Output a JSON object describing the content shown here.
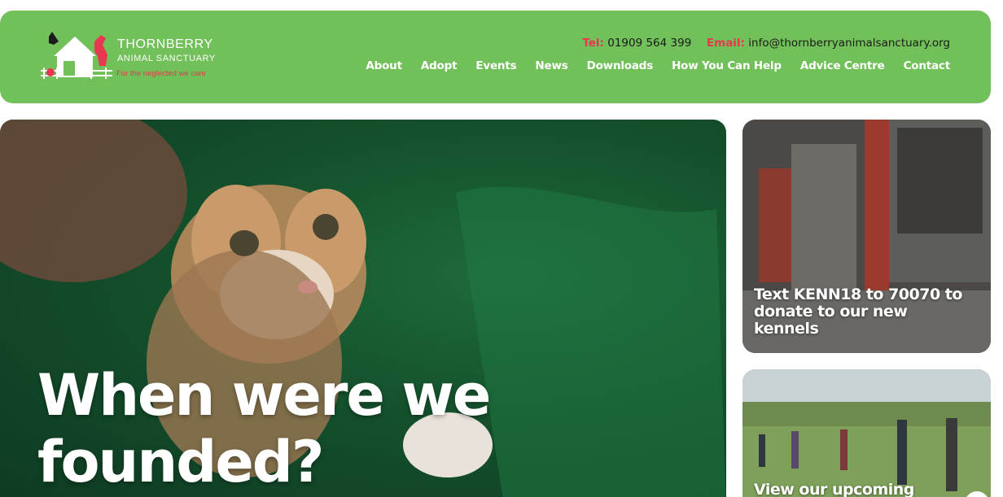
{
  "brand": {
    "name": "THORNBERRY",
    "subtitle": "ANIMAL SANCTUARY",
    "tagline": "For the neglected we care"
  },
  "contact": {
    "tel_label": "Tel:",
    "tel": "01909 564 399",
    "email_label": "Email:",
    "email": "info@thornberryanimalsanctuary.org"
  },
  "nav": {
    "items": [
      "About",
      "Adopt",
      "Events",
      "News",
      "Downloads",
      "How You Can Help",
      "Advice Centre",
      "Contact"
    ]
  },
  "hero": {
    "title": "When were we founded?"
  },
  "cards": [
    {
      "text": "Text KENN18 to 70070 to donate to our new kennels"
    },
    {
      "text": "View our upcoming"
    }
  ],
  "colors": {
    "header_green": "#72c05a",
    "accent_red": "#e8384f",
    "hero_green": "#14502c"
  }
}
